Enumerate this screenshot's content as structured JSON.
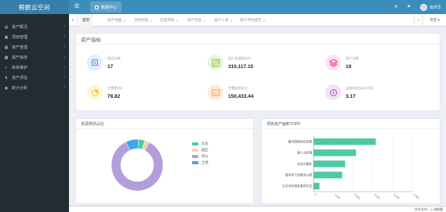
{
  "app": {
    "brand": "鲸鹏云空间"
  },
  "topbar": {
    "active_tab": "数据中心",
    "user_name": "张鸿华",
    "mail_icon": "mail-icon",
    "bell_icon": "bell-icon"
  },
  "sidebar": {
    "items": [
      {
        "label": "资产概况",
        "icon": "chart-icon"
      },
      {
        "label": "项目管理",
        "icon": "folder-icon"
      },
      {
        "label": "资产管理",
        "icon": "box-icon"
      },
      {
        "label": "资产库存",
        "icon": "stack-icon"
      },
      {
        "label": "库存维护",
        "icon": "wrench-icon"
      },
      {
        "label": "资产评估",
        "icon": "scale-icon"
      },
      {
        "label": "统计分析",
        "icon": "stats-icon"
      }
    ]
  },
  "tabstrip": {
    "tabs": [
      "首页",
      "资产地图",
      "项目档案",
      "在建项目",
      "资产档案",
      "资产入库",
      "资产评估报告"
    ],
    "right_label": "页签"
  },
  "kpi_panel": {
    "title": "资产指标",
    "items": [
      {
        "label": "项目总数",
        "value": "17",
        "color": "#5b9bd5",
        "bg": "#e3edfb",
        "icon": "list-icon"
      },
      {
        "label": "资产总面积(m²)",
        "value": "310,117.15",
        "color": "#8bc34a",
        "bg": "#eaf6de",
        "icon": "hatch-icon"
      },
      {
        "label": "资产总数",
        "value": "19",
        "color": "#e91e8c",
        "bg": "#fbe3f0",
        "icon": "layers-icon"
      },
      {
        "label": "空置率(%)",
        "value": "78.82",
        "color": "#f5c518",
        "bg": "#fdf6d8",
        "icon": "pie-icon"
      },
      {
        "label": "空置面积(m²)",
        "value": "150,433.44",
        "color": "#f39c4b",
        "bg": "#fdebd9",
        "icon": "m2-icon"
      },
      {
        "label": "当前均价(元/m²/月)",
        "value": "3.17",
        "color": "#ab47bc",
        "bg": "#f3e3f7",
        "icon": "yuan-icon"
      }
    ]
  },
  "donut_panel": {
    "title": "资源类别占比"
  },
  "bar_panel": {
    "title": "项目资产面积TOP5"
  },
  "chart_data": [
    {
      "type": "pie",
      "title": "资源类别占比",
      "categories": [
        "车位",
        "园区",
        "村公",
        "土地"
      ],
      "values": [
        4,
        3,
        85,
        8
      ],
      "colors": [
        "#4fc9a4",
        "#f6d3a8",
        "#b39ddb",
        "#3ea7e8"
      ],
      "legend": "right"
    },
    {
      "type": "bar",
      "orientation": "horizontal",
      "title": "项目资产面积TOP5",
      "categories": [
        "唐市国税局综合楼",
        "唐人大商铺",
        "北京办事处",
        "唐市老干部服务公楼",
        "太仓市区城发展研究会"
      ],
      "values": [
        3150,
        2150,
        1600,
        1450,
        300
      ],
      "color": "#4fc9a4",
      "xlim": [
        0,
        5000
      ],
      "xticks": [
        "0",
        "1,000",
        "2,000",
        "3,000",
        "4,000",
        "5,000"
      ]
    }
  ],
  "footer": {
    "text": "技术支持：上海鲸鹏"
  }
}
